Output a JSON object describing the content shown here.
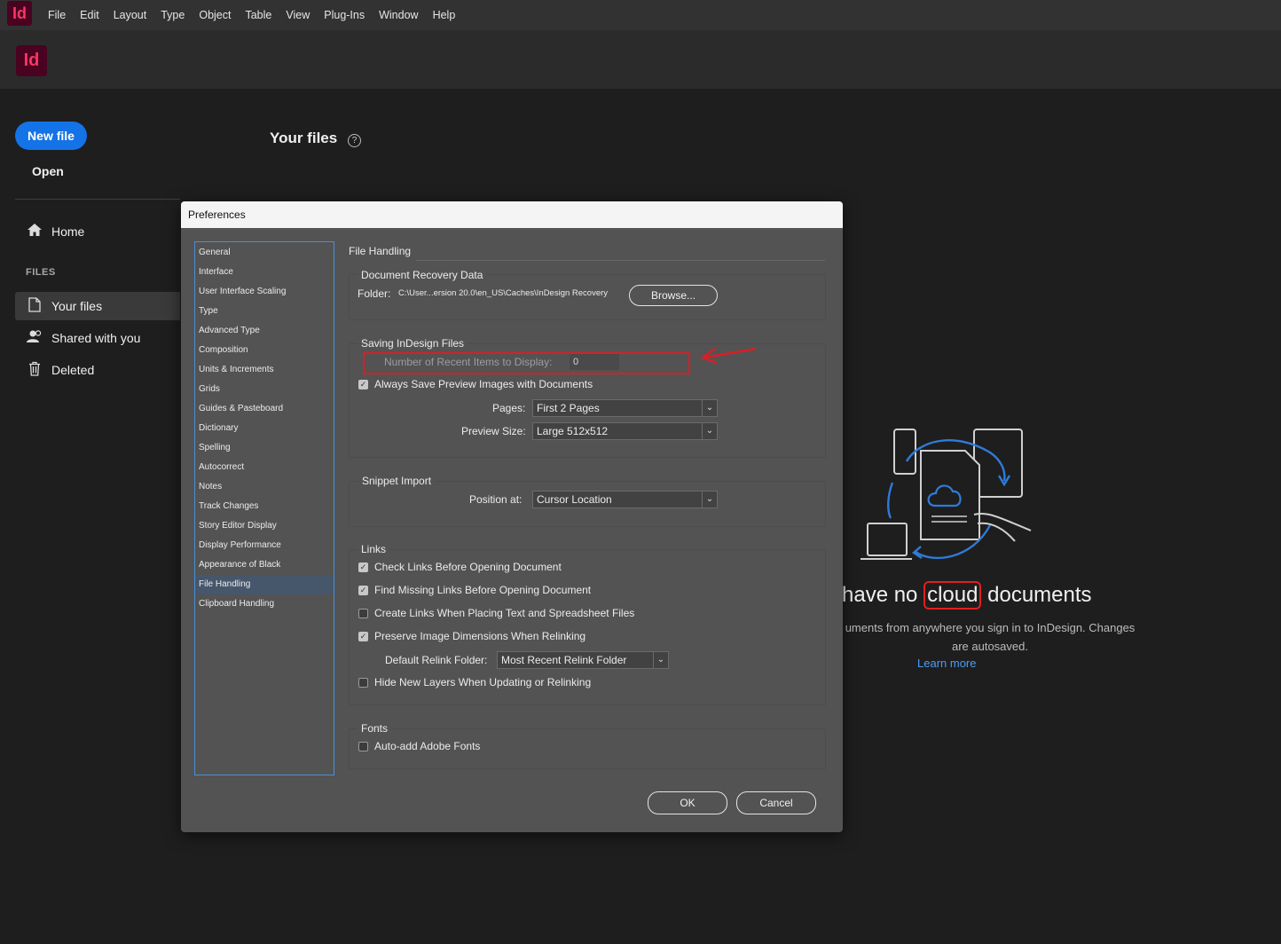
{
  "menubar": {
    "logo": "Id",
    "items": [
      "File",
      "Edit",
      "Layout",
      "Type",
      "Object",
      "Table",
      "View",
      "Plug-Ins",
      "Window",
      "Help"
    ]
  },
  "header": {
    "logo": "Id"
  },
  "sidebar": {
    "new_file": "New file",
    "open": "Open",
    "home": "Home",
    "files_label": "FILES",
    "your_files": "Your files",
    "shared": "Shared with you",
    "deleted": "Deleted"
  },
  "main": {
    "title": "Your files",
    "empty_title_before": "have no ",
    "empty_title_circled": "cloud",
    "empty_title_after": " documents",
    "empty_desc": "uments from anywhere you sign in to InDesign. Changes are autosaved.",
    "learn_more": "Learn more"
  },
  "dialog": {
    "title": "Preferences",
    "categories": [
      "General",
      "Interface",
      "User Interface Scaling",
      "Type",
      "Advanced Type",
      "Composition",
      "Units & Increments",
      "Grids",
      "Guides & Pasteboard",
      "Dictionary",
      "Spelling",
      "Autocorrect",
      "Notes",
      "Track Changes",
      "Story Editor Display",
      "Display Performance",
      "Appearance of Black",
      "File Handling",
      "Clipboard Handling"
    ],
    "selected_category": "File Handling",
    "section_title": "File Handling",
    "recovery": {
      "label": "Document Recovery Data",
      "folder_label": "Folder:",
      "folder_path": "C:\\User...ersion 20.0\\en_US\\Caches\\InDesign Recovery",
      "browse": "Browse..."
    },
    "saving": {
      "label": "Saving InDesign Files",
      "recent_label": "Number of Recent Items to Display:",
      "recent_value": "0",
      "preview_label": "Always Save Preview Images with Documents",
      "preview_checked": true,
      "pages_label": "Pages:",
      "pages_value": "First 2 Pages",
      "size_label": "Preview Size:",
      "size_value": "Large 512x512"
    },
    "snippet": {
      "label": "Snippet Import",
      "position_label": "Position at:",
      "position_value": "Cursor Location"
    },
    "links": {
      "label": "Links",
      "check_links": "Check Links Before Opening Document",
      "check_links_checked": true,
      "find_missing": "Find Missing Links Before Opening Document",
      "find_missing_checked": true,
      "create_links": "Create Links When Placing Text and Spreadsheet Files",
      "create_links_checked": false,
      "preserve": "Preserve Image Dimensions When Relinking",
      "preserve_checked": true,
      "relink_label": "Default Relink Folder:",
      "relink_value": "Most Recent Relink Folder",
      "hide_layers": "Hide New Layers When Updating or Relinking",
      "hide_layers_checked": false
    },
    "fonts": {
      "label": "Fonts",
      "auto_add": "Auto-add Adobe Fonts",
      "auto_add_checked": false
    },
    "ok": "OK",
    "cancel": "Cancel"
  },
  "colors": {
    "accent": "#1473e6",
    "annotation": "#d81f26",
    "brand": "#ff3366",
    "selection": "#46566b"
  }
}
